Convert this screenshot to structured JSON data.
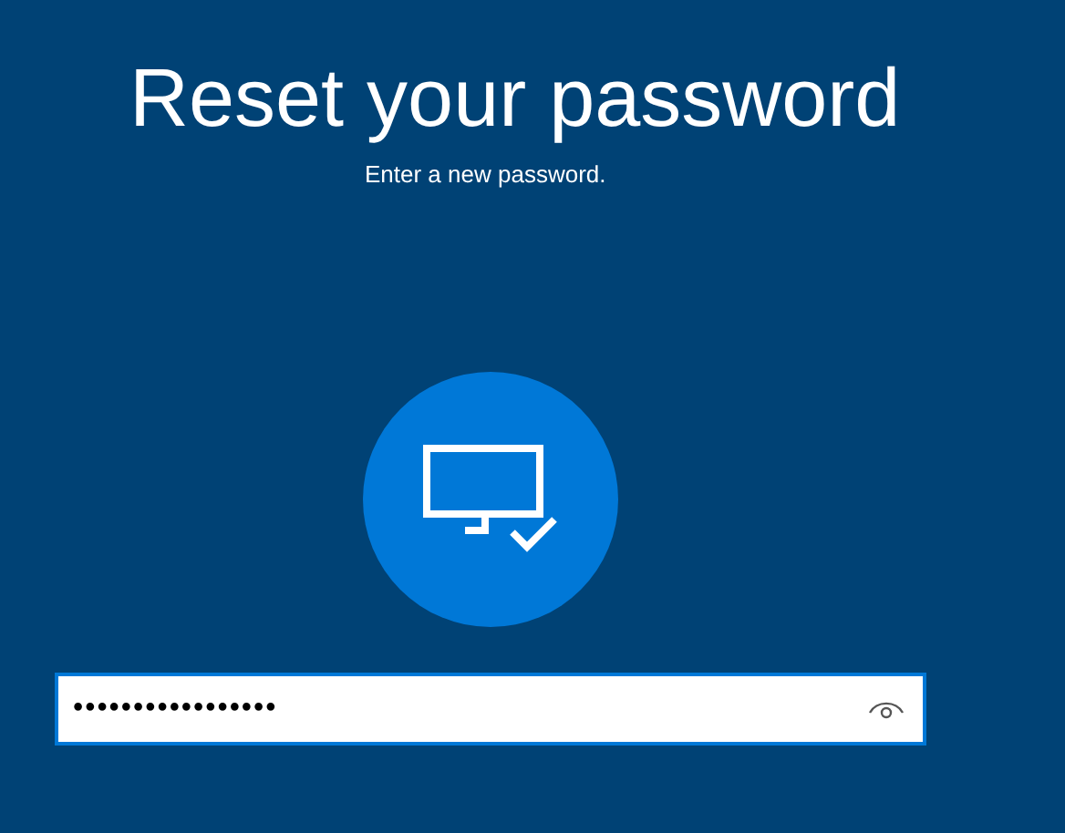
{
  "title": "Reset your password",
  "subtitle": "Enter a new password.",
  "password_field": {
    "value": "•••••••••••••••••",
    "focused": true
  }
}
